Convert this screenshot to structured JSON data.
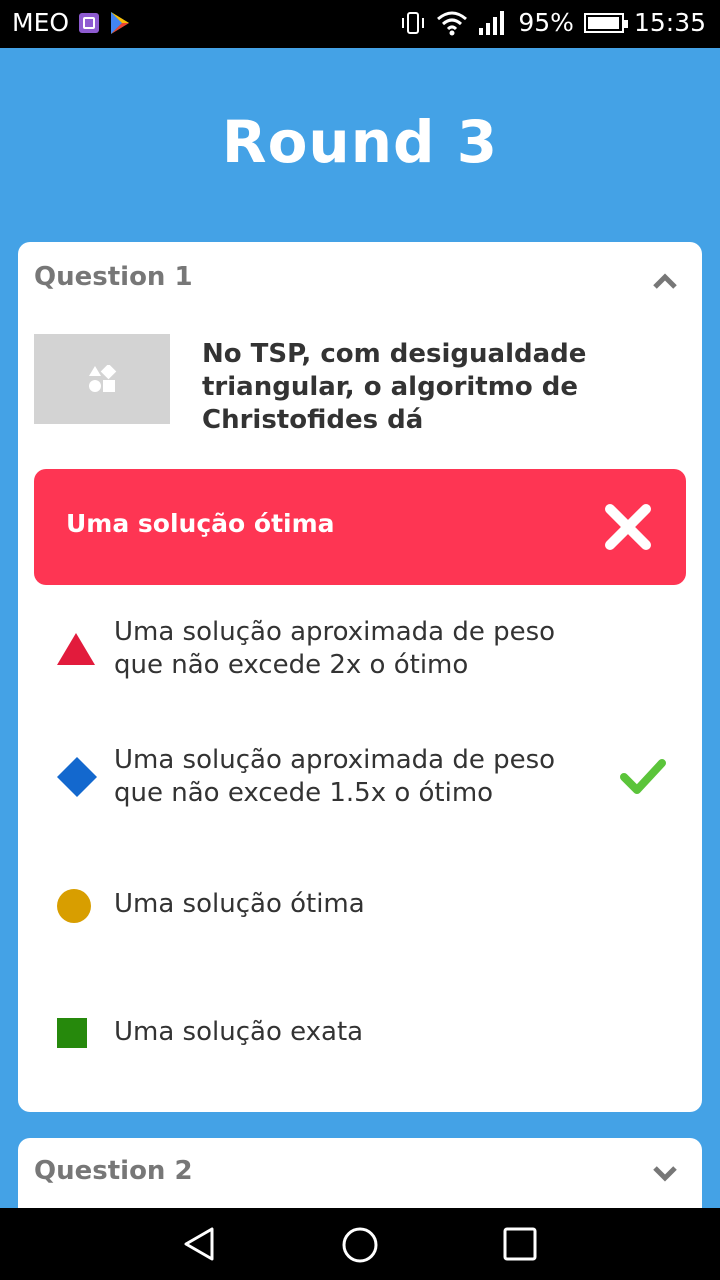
{
  "status_bar": {
    "carrier": "MEO",
    "battery_percent": "95%",
    "time": "15:35"
  },
  "page": {
    "title": "Round 3"
  },
  "questions": [
    {
      "label": "Question 1",
      "text": "No TSP, com desigualdade triangular, o algoritmo de Christofides dá",
      "selected_answer": "Uma solução ótima",
      "options": [
        {
          "text": "Uma solução aproximada de peso que não excede 2x o ótimo",
          "shape": "triangle",
          "color": "#e21b3c",
          "correct": false
        },
        {
          "text": "Uma solução aproximada de peso que não excede 1.5x o ótimo",
          "shape": "diamond",
          "color": "#1368ce",
          "correct": true
        },
        {
          "text": "Uma solução ótima",
          "shape": "circle",
          "color": "#d89e00",
          "correct": false
        },
        {
          "text": "Uma solução exata",
          "shape": "square",
          "color": "#26890c",
          "correct": false
        }
      ],
      "expanded": true
    },
    {
      "label": "Question 2",
      "expanded": false
    }
  ],
  "colors": {
    "background": "#44a2e6",
    "wrong_answer": "#fe3553",
    "correct_check": "#5bc43a"
  }
}
